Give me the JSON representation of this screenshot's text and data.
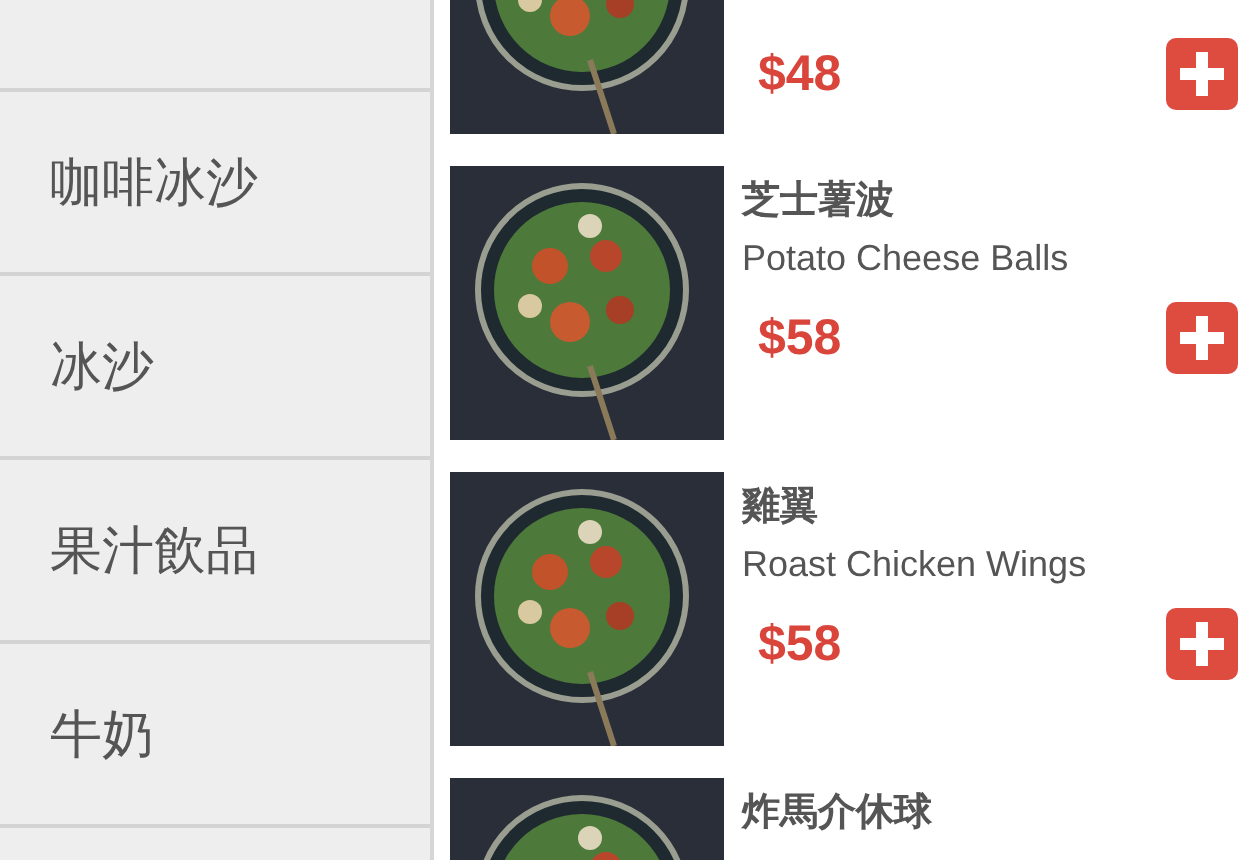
{
  "categories": [
    {
      "selected": false
    },
    {
      "label": "咖啡冰沙",
      "selected": false
    },
    {
      "label": "冰沙",
      "selected": false
    },
    {
      "label": "果汁飲品",
      "selected": false
    },
    {
      "label": "牛奶",
      "selected": false
    },
    {
      "selected": false
    }
  ],
  "products": [
    {
      "price": "$48"
    },
    {
      "name": "芝士薯波",
      "english": "Potato Cheese Balls",
      "price": "$58"
    },
    {
      "name": "雞翼",
      "english": "Roast Chicken Wings",
      "price": "$58"
    },
    {
      "name": "炸馬介休球"
    }
  ]
}
